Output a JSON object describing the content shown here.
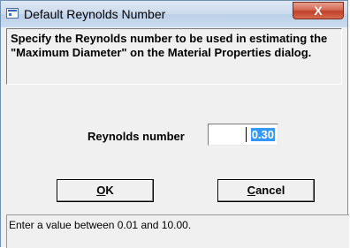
{
  "window": {
    "title": "Default Reynolds Number",
    "close_label": "X"
  },
  "description": "Specify the Reynolds number to be used in estimating the \"Maximum Diameter\" on the Material Properties dialog.",
  "field": {
    "label": "Reynolds number",
    "value": "0.30"
  },
  "buttons": {
    "ok": {
      "prefix": "",
      "accel": "O",
      "rest": "K"
    },
    "cancel": {
      "prefix": "",
      "accel": "C",
      "rest": "ancel"
    }
  },
  "status": "Enter a value between 0.01 and 10.00.",
  "colors": {
    "selection": "#3399ff",
    "close": "#c0412a",
    "titlebar": "#cbdaec"
  }
}
